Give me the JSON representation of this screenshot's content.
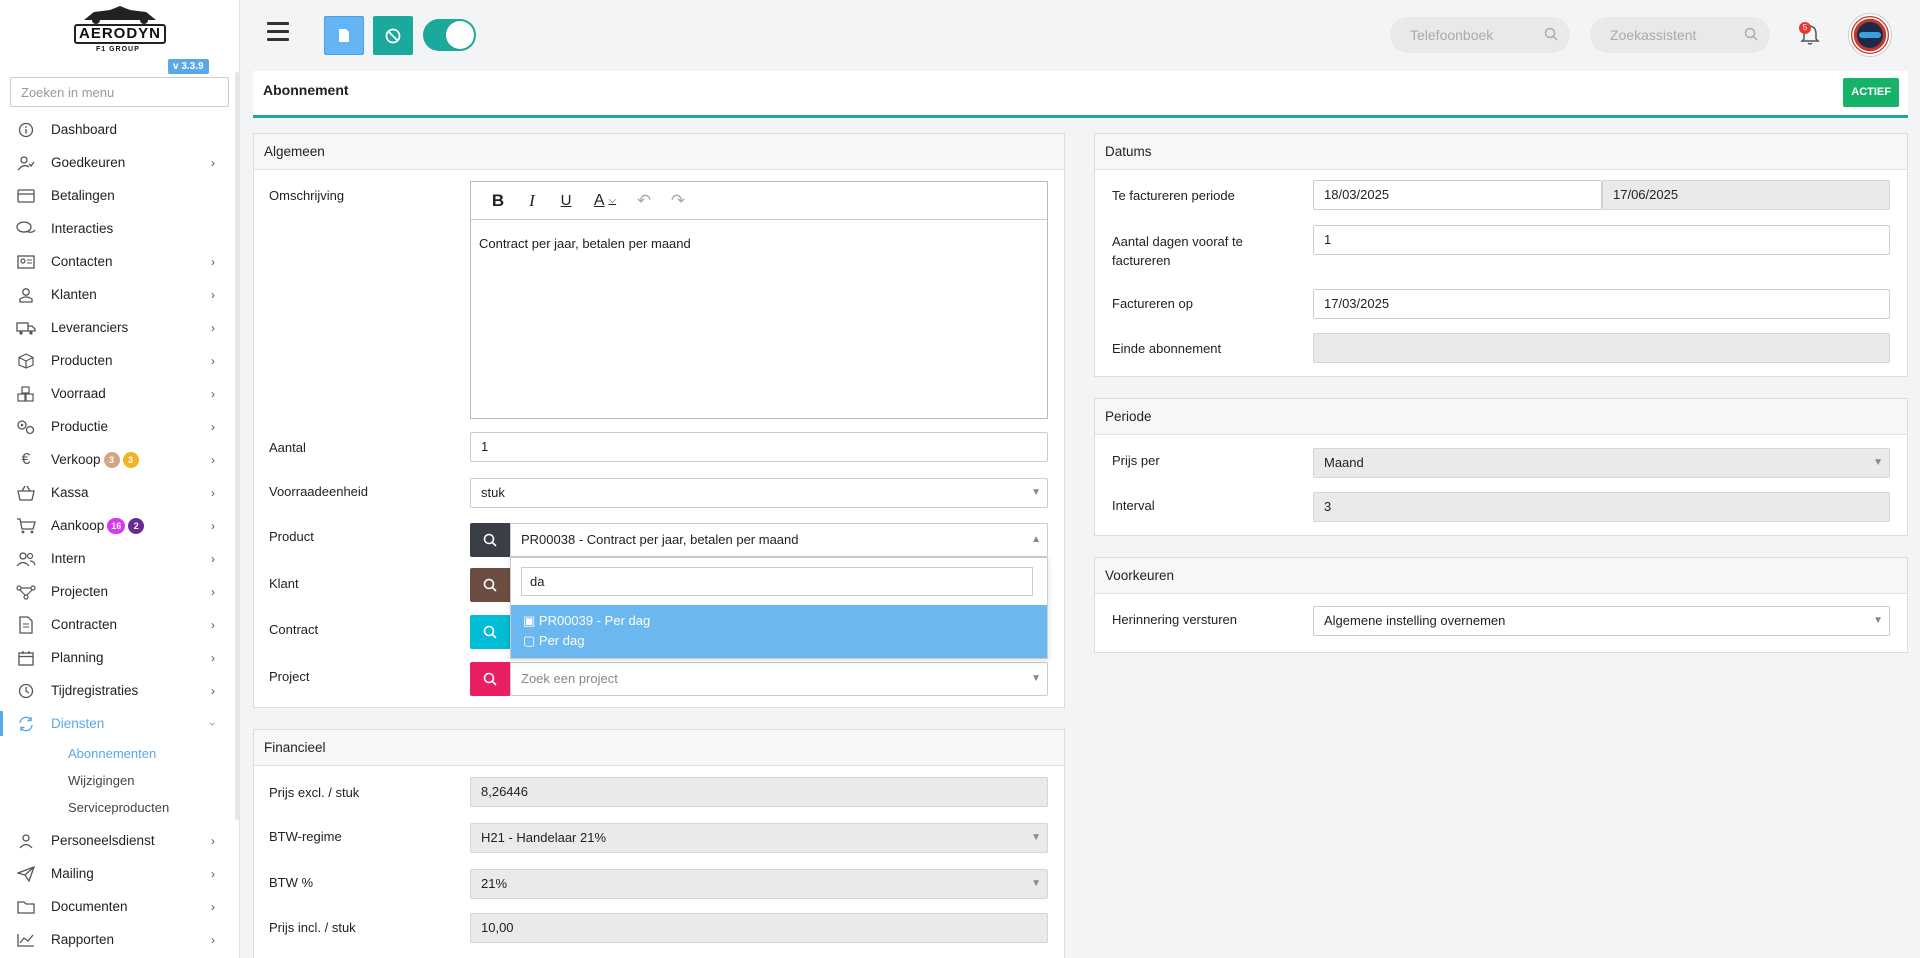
{
  "app": {
    "logo_text": "AERODYN",
    "logo_subtext": "F1 GROUP",
    "version": "v 3.3.9"
  },
  "sidebar": {
    "search_placeholder": "Zoeken in menu",
    "items": [
      {
        "label": "Dashboard",
        "icon": "info-circle-icon",
        "has_children": false
      },
      {
        "label": "Goedkeuren",
        "icon": "user-check-icon",
        "has_children": true
      },
      {
        "label": "Betalingen",
        "icon": "credit-card-icon",
        "has_children": false
      },
      {
        "label": "Interacties",
        "icon": "chat-bubbles-icon",
        "has_children": false
      },
      {
        "label": "Contacten",
        "icon": "contact-card-icon",
        "has_children": true
      },
      {
        "label": "Klanten",
        "icon": "person-icon",
        "has_children": true
      },
      {
        "label": "Leveranciers",
        "icon": "truck-icon",
        "has_children": true
      },
      {
        "label": "Producten",
        "icon": "box-icon",
        "has_children": true
      },
      {
        "label": "Voorraad",
        "icon": "boxes-icon",
        "has_children": true
      },
      {
        "label": "Productie",
        "icon": "gears-icon",
        "has_children": true
      },
      {
        "label": "Verkoop",
        "icon": "euro-icon",
        "has_children": true,
        "badges": [
          {
            "text": "3",
            "color": "#d9a386"
          },
          {
            "text": "3",
            "color": "#f0b429"
          }
        ]
      },
      {
        "label": "Kassa",
        "icon": "basket-icon",
        "has_children": true
      },
      {
        "label": "Aankoop",
        "icon": "cart-icon",
        "has_children": true,
        "badges": [
          {
            "text": "16",
            "color": "#d63af0"
          },
          {
            "text": "2",
            "color": "#6a2c91"
          }
        ]
      },
      {
        "label": "Intern",
        "icon": "users-icon",
        "has_children": true
      },
      {
        "label": "Projecten",
        "icon": "project-nodes-icon",
        "has_children": true
      },
      {
        "label": "Contracten",
        "icon": "contract-icon",
        "has_children": true
      },
      {
        "label": "Planning",
        "icon": "calendar-icon",
        "has_children": true
      },
      {
        "label": "Tijdregistraties",
        "icon": "timer-icon",
        "has_children": true
      },
      {
        "label": "Diensten",
        "icon": "sync-icon",
        "has_children": true,
        "active": true
      }
    ],
    "sub_items": [
      {
        "label": "Abonnementen",
        "active": true
      },
      {
        "label": "Wijzigingen",
        "active": false
      },
      {
        "label": "Serviceproducten",
        "active": false
      }
    ],
    "items_after": [
      {
        "label": "Personeelsdienst",
        "icon": "person-badge-icon",
        "has_children": true
      },
      {
        "label": "Mailing",
        "icon": "paper-plane-icon",
        "has_children": true
      },
      {
        "label": "Documenten",
        "icon": "folder-icon",
        "has_children": true
      },
      {
        "label": "Rapporten",
        "icon": "chart-line-icon",
        "has_children": true
      }
    ]
  },
  "topbar": {
    "phonebook_placeholder": "Telefoonboek",
    "assistant_placeholder": "Zoekassistent",
    "notification_count": "5"
  },
  "header": {
    "title": "Abonnement",
    "status": "ACTIEF"
  },
  "algemeen": {
    "title": "Algemeen",
    "omschrijving_label": "Omschrijving",
    "omschrijving_value": "Contract per jaar, betalen per maand",
    "aantal_label": "Aantal",
    "aantal_value": "1",
    "voorraadeenheid_label": "Voorraadeenheid",
    "voorraadeenheid_value": "stuk",
    "product_label": "Product",
    "product_value": "PR00038 - Contract per jaar, betalen per maand",
    "klant_label": "Klant",
    "contract_label": "Contract",
    "project_label": "Project",
    "project_placeholder": "Zoek een project",
    "dropdown": {
      "search_value": "da",
      "option_line1": "PR00039 - Per dag",
      "option_line2": "Per dag"
    }
  },
  "financieel": {
    "title": "Financieel",
    "prijs_excl_label": "Prijs excl. / stuk",
    "prijs_excl_value": "8,26446",
    "btw_regime_label": "BTW-regime",
    "btw_regime_value": "H21 - Handelaar 21%",
    "btw_pct_label": "BTW %",
    "btw_pct_value": "21%",
    "prijs_incl_label": "Prijs incl. / stuk",
    "prijs_incl_value": "10,00"
  },
  "datums": {
    "title": "Datums",
    "periode_label": "Te factureren periode",
    "periode_start": "18/03/2025",
    "periode_end": "17/06/2025",
    "dagen_label": "Aantal dagen vooraf te factureren",
    "dagen_value": "1",
    "factureren_op_label": "Factureren op",
    "factureren_op_value": "17/03/2025",
    "einde_label": "Einde abonnement",
    "einde_value": ""
  },
  "periode": {
    "title": "Periode",
    "prijs_per_label": "Prijs per",
    "prijs_per_value": "Maand",
    "interval_label": "Interval",
    "interval_value": "3"
  },
  "voorkeuren": {
    "title": "Voorkeuren",
    "herinnering_label": "Herinnering versturen",
    "herinnering_value": "Algemene instelling overnemen"
  },
  "colors": {
    "accent": "#5aa9e6",
    "teal": "#1aa99a",
    "status_green": "#17b26a",
    "search_dark": "#3a3f47",
    "search_brown": "#6d4c41",
    "search_cyan": "#00bcd4",
    "search_pink": "#e91e63"
  }
}
